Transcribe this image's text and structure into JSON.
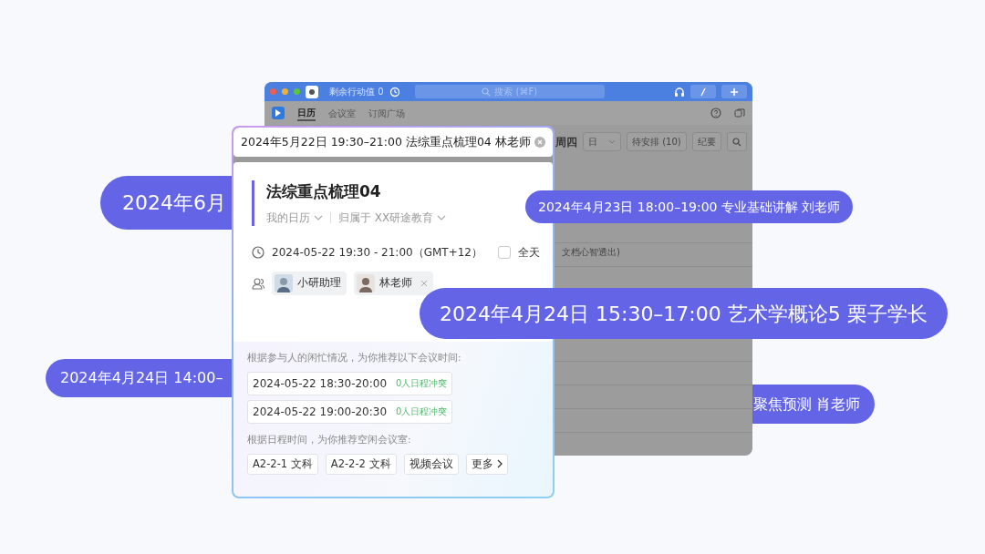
{
  "app_window": {
    "action_points": "剩余行动值 0",
    "search_placeholder": "搜索 (⌘F)",
    "tabs": [
      {
        "label": "日历",
        "selected": true
      },
      {
        "label": "会议室",
        "selected": false
      },
      {
        "label": "订阅广场",
        "selected": false
      }
    ],
    "weekday": "周四",
    "view": "日",
    "pending": "待安排 (10)",
    "minutes": "纪要",
    "event_text": "文档心智透出)"
  },
  "event_popup": {
    "search_value": "2024年5月22日 19:30–21:00 法综重点梳理04 林老师",
    "title": "法综重点梳理04",
    "calendar": "我的日历",
    "organization": "归属于 XX研途教育",
    "time": "2024-05-22 19:30 - 21:00（GMT+12）",
    "all_day": {
      "label": "全天",
      "checked": false
    },
    "attendees": [
      {
        "name": "小研助理",
        "removable": false
      },
      {
        "name": "林老师",
        "removable": true
      }
    ],
    "time_hint": "根据参与人的闲忙情况，为你推荐以下会议时间:",
    "time_suggestions": [
      {
        "time": "2024-05-22 18:30-20:00",
        "conflicts": "0人日程冲突"
      },
      {
        "time": "2024-05-22 19:00-20:30",
        "conflicts": "0人日程冲突"
      }
    ],
    "room_hint": "根据日程时间，为你推荐空闲会议室:",
    "room_options": [
      "A2-2-1 文科",
      "A2-2-2 文科",
      "视频会议"
    ],
    "more": "更多"
  },
  "floating_events": [
    {
      "text": "2024年6月",
      "in_front": false
    },
    {
      "text": "2024年4月23日 18:00–19:00 专业基础讲解 刘老师",
      "in_front": true
    },
    {
      "text": "2024年4月24日 15:30–17:00 艺术学概论5 栗子学长",
      "in_front": true
    },
    {
      "text": "2024年4月24日 14:00–",
      "in_front": false
    },
    {
      "text": "聚焦预测 肖老师",
      "in_front": false
    }
  ]
}
